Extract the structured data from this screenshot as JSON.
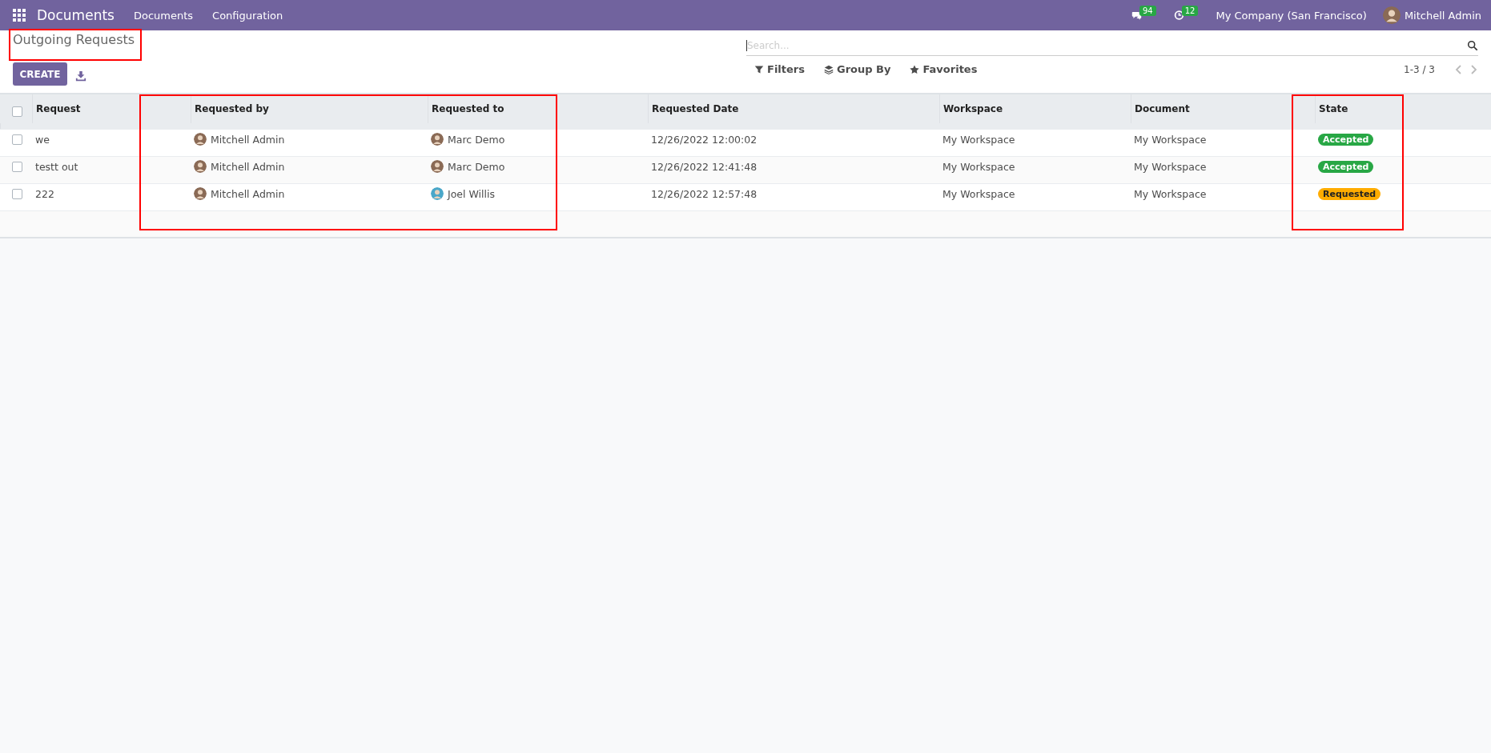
{
  "navbar": {
    "app_name": "Documents",
    "menu": [
      "Documents",
      "Configuration"
    ],
    "messages_count": "94",
    "activities_count": "12",
    "company": "My Company (San Francisco)",
    "user": "Mitchell Admin"
  },
  "control_panel": {
    "title": "Outgoing Requests",
    "create_label": "CREATE",
    "search": {
      "placeholder": "Search..."
    },
    "filters": [
      "Filters",
      "Group By",
      "Favorites"
    ],
    "pager": "1-3 / 3"
  },
  "table": {
    "select_all": false,
    "columns": [
      "Request",
      "Requested by",
      "Requested to",
      "Requested Date",
      "Workspace",
      "Document",
      "State"
    ],
    "rows": [
      {
        "checked": false,
        "request": "we",
        "requested_by": "Mitchell Admin",
        "requested_to": "Marc Demo",
        "date": "12/26/2022 12:00:02",
        "workspace": "My Workspace",
        "document": "My Workspace",
        "state": {
          "label": "Accepted",
          "color": "#28a745"
        }
      },
      {
        "checked": false,
        "request": "testt out",
        "requested_by": "Mitchell Admin",
        "requested_to": "Marc Demo",
        "date": "12/26/2022 12:41:48",
        "workspace": "My Workspace",
        "document": "My Workspace",
        "state": {
          "label": "Accepted",
          "color": "#28a745"
        }
      },
      {
        "checked": false,
        "request": "222",
        "requested_by": "Mitchell Admin",
        "requested_to": "Joel Willis",
        "date": "12/26/2022 12:57:48",
        "workspace": "My Workspace",
        "document": "My Workspace",
        "state": {
          "label": "Requested",
          "color": "#ffac00"
        }
      }
    ]
  }
}
